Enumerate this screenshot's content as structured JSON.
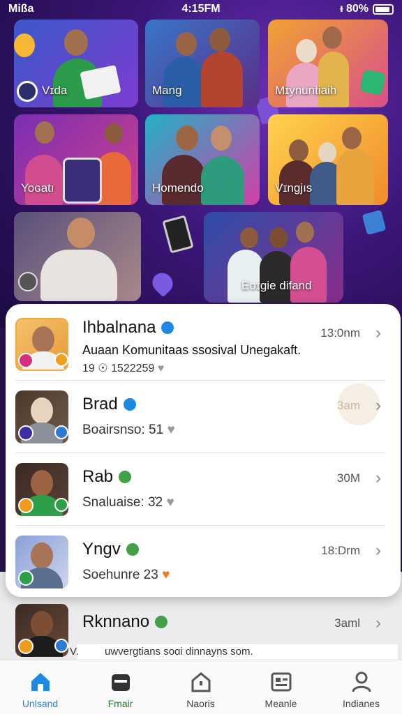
{
  "status_bar": {
    "carrier": "Mißa",
    "time": "4:15FM",
    "battery": "ᵻ 80%"
  },
  "tiles": [
    {
      "label": "Vɪda"
    },
    {
      "label": "Mang"
    },
    {
      "label": "Mɪynuntiaih"
    },
    {
      "label": "Yoɢatı"
    },
    {
      "label": "Homendo"
    },
    {
      "label": "Vɪngjıs"
    },
    {
      "label": ""
    },
    {
      "label": "Eoɪgie difand"
    }
  ],
  "list": [
    {
      "name": "Ihbalnana",
      "desc": "Auaan Komunitaas ssosival Unegakaft.",
      "meta": "19 ☉ 1522259",
      "time": "13:0nm",
      "verified_color": "#1e88e5"
    },
    {
      "name": "Brad",
      "sub": "Boairsnso: 51",
      "time": "3am",
      "verified_color": "#1e88e5"
    },
    {
      "name": "Rab",
      "sub": "Snaluaise: 3̇2",
      "time": "30M",
      "verified_color": "#43a047"
    },
    {
      "name": "Yngv",
      "sub": "Soehunre 23",
      "time": "18:Drm",
      "verified_color": "#43a047"
    },
    {
      "name": "Rknnano",
      "time": "3aml",
      "verified_color": "#43a047"
    }
  ],
  "footer_text": "uwvergtians soɑi dinnayns som.",
  "footer_prefix": "V.",
  "nav": [
    {
      "label": "Unlsand",
      "icon": "home-icon",
      "color": "#1e88e5"
    },
    {
      "label": "Fmair",
      "icon": "inbox-icon",
      "color": "#2e7d32"
    },
    {
      "label": "Naoris",
      "icon": "house-outline-icon",
      "color": "#444"
    },
    {
      "label": "Meanle",
      "icon": "id-card-icon",
      "color": "#444"
    },
    {
      "label": "Indianes",
      "icon": "person-icon",
      "color": "#444"
    }
  ]
}
